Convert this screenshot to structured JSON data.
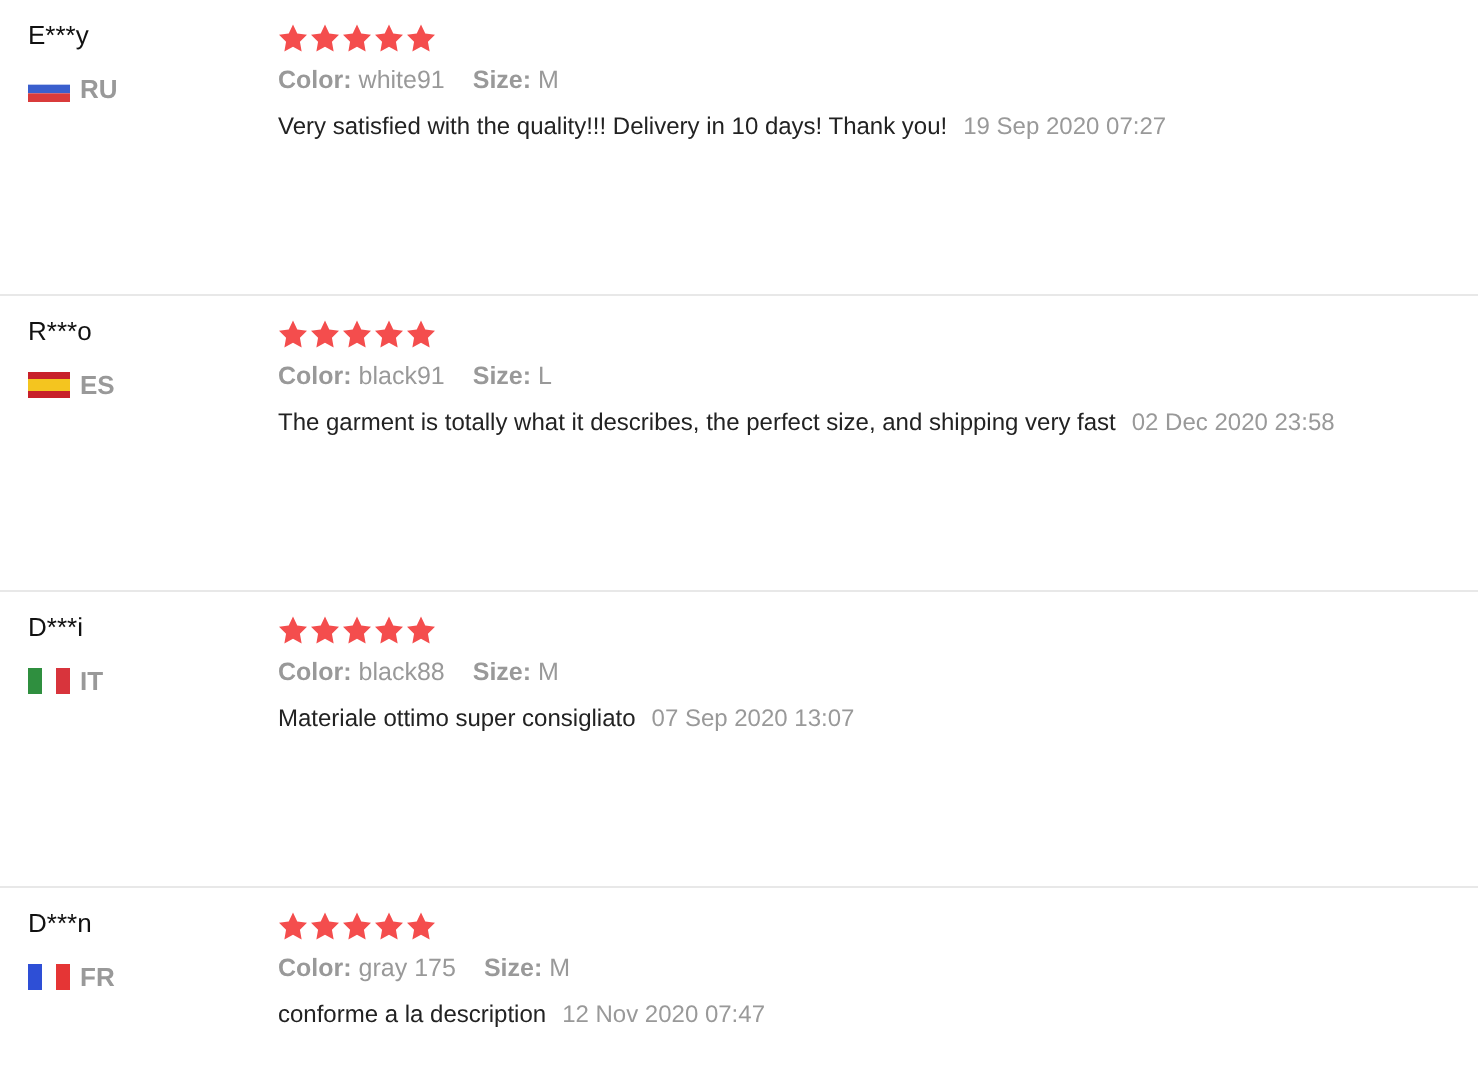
{
  "reviews": [
    {
      "name": "E***y",
      "kind": "ru",
      "country": "RU",
      "stars": 5,
      "color_label": "Color:",
      "color_value": "white91",
      "size_label": "Size:",
      "size_value": "M",
      "text": "Very satisfied with the quality!!! Delivery in 10 days! Thank you!",
      "date": "19 Sep 2020 07:27"
    },
    {
      "name": "R***o",
      "kind": "es",
      "country": "ES",
      "stars": 5,
      "color_label": "Color:",
      "color_value": "black91",
      "size_label": "Size:",
      "size_value": "L",
      "text": "The garment is totally what it describes, the perfect size, and shipping very fast",
      "date": "02 Dec 2020 23:58"
    },
    {
      "name": "D***i",
      "kind": "it",
      "country": "IT",
      "stars": 5,
      "color_label": "Color:",
      "color_value": "black88",
      "size_label": "Size:",
      "size_value": "M",
      "text": "Materiale ottimo super consigliato",
      "date": "07 Sep 2020 13:07"
    },
    {
      "name": "D***n",
      "kind": "fr",
      "country": "FR",
      "stars": 5,
      "color_label": "Color:",
      "color_value": "gray 175",
      "size_label": "Size:",
      "size_value": "M",
      "text": "conforme a la description",
      "date": "12 Nov 2020 07:47"
    }
  ]
}
